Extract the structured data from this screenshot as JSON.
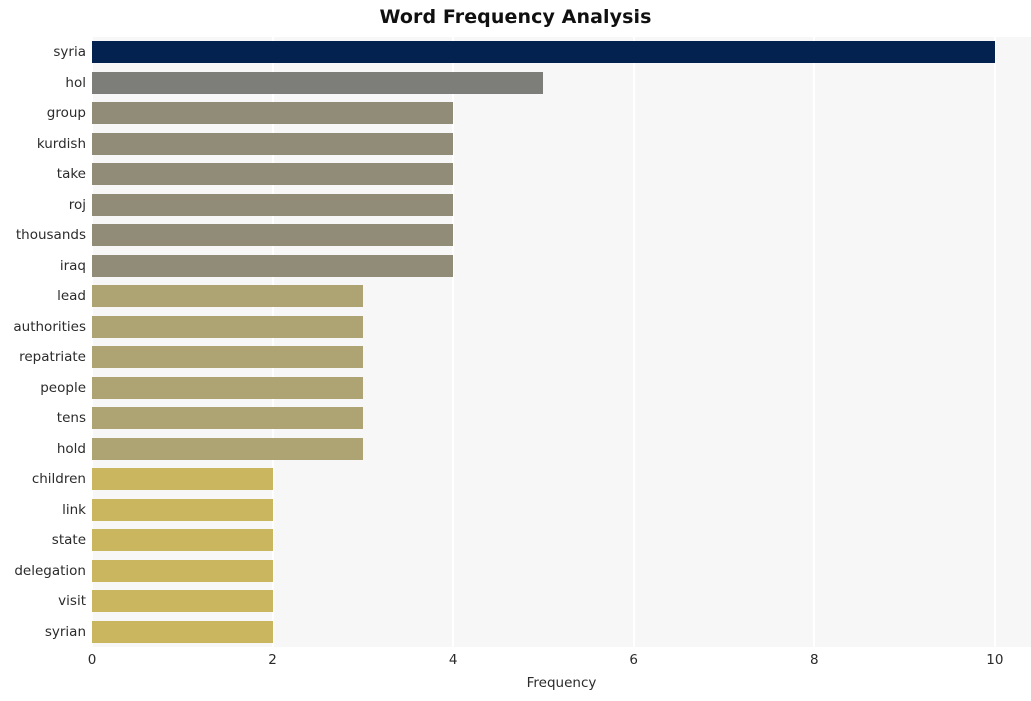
{
  "chart_data": {
    "type": "bar",
    "orientation": "horizontal",
    "title": "Word Frequency Analysis",
    "xlabel": "Frequency",
    "ylabel": "",
    "xlim": [
      0,
      10.4
    ],
    "xticks": [
      0,
      2,
      4,
      6,
      8,
      10
    ],
    "xtick_labels": [
      "0",
      "2",
      "4",
      "6",
      "8",
      "10"
    ],
    "grid": true,
    "grid_color": "#ffffff",
    "legend": false,
    "plot_background": "#f7f7f7",
    "figure_background": "#ffffff",
    "categories": [
      "syria",
      "hol",
      "group",
      "kurdish",
      "take",
      "roj",
      "thousands",
      "iraq",
      "lead",
      "authorities",
      "repatriate",
      "people",
      "tens",
      "hold",
      "children",
      "link",
      "state",
      "delegation",
      "visit",
      "syrian"
    ],
    "values": [
      10,
      5,
      4,
      4,
      4,
      4,
      4,
      4,
      3,
      3,
      3,
      3,
      3,
      3,
      2,
      2,
      2,
      2,
      2,
      2
    ],
    "bar_colors": [
      "#032250",
      "#7d7d7a",
      "#918c77",
      "#918c77",
      "#918c77",
      "#918c77",
      "#918c77",
      "#918c77",
      "#aea473",
      "#aea473",
      "#aea473",
      "#aea473",
      "#aea473",
      "#aea473",
      "#c9b65f",
      "#c9b65f",
      "#c9b65f",
      "#c9b65f",
      "#c9b65f",
      "#c9b65f"
    ]
  }
}
